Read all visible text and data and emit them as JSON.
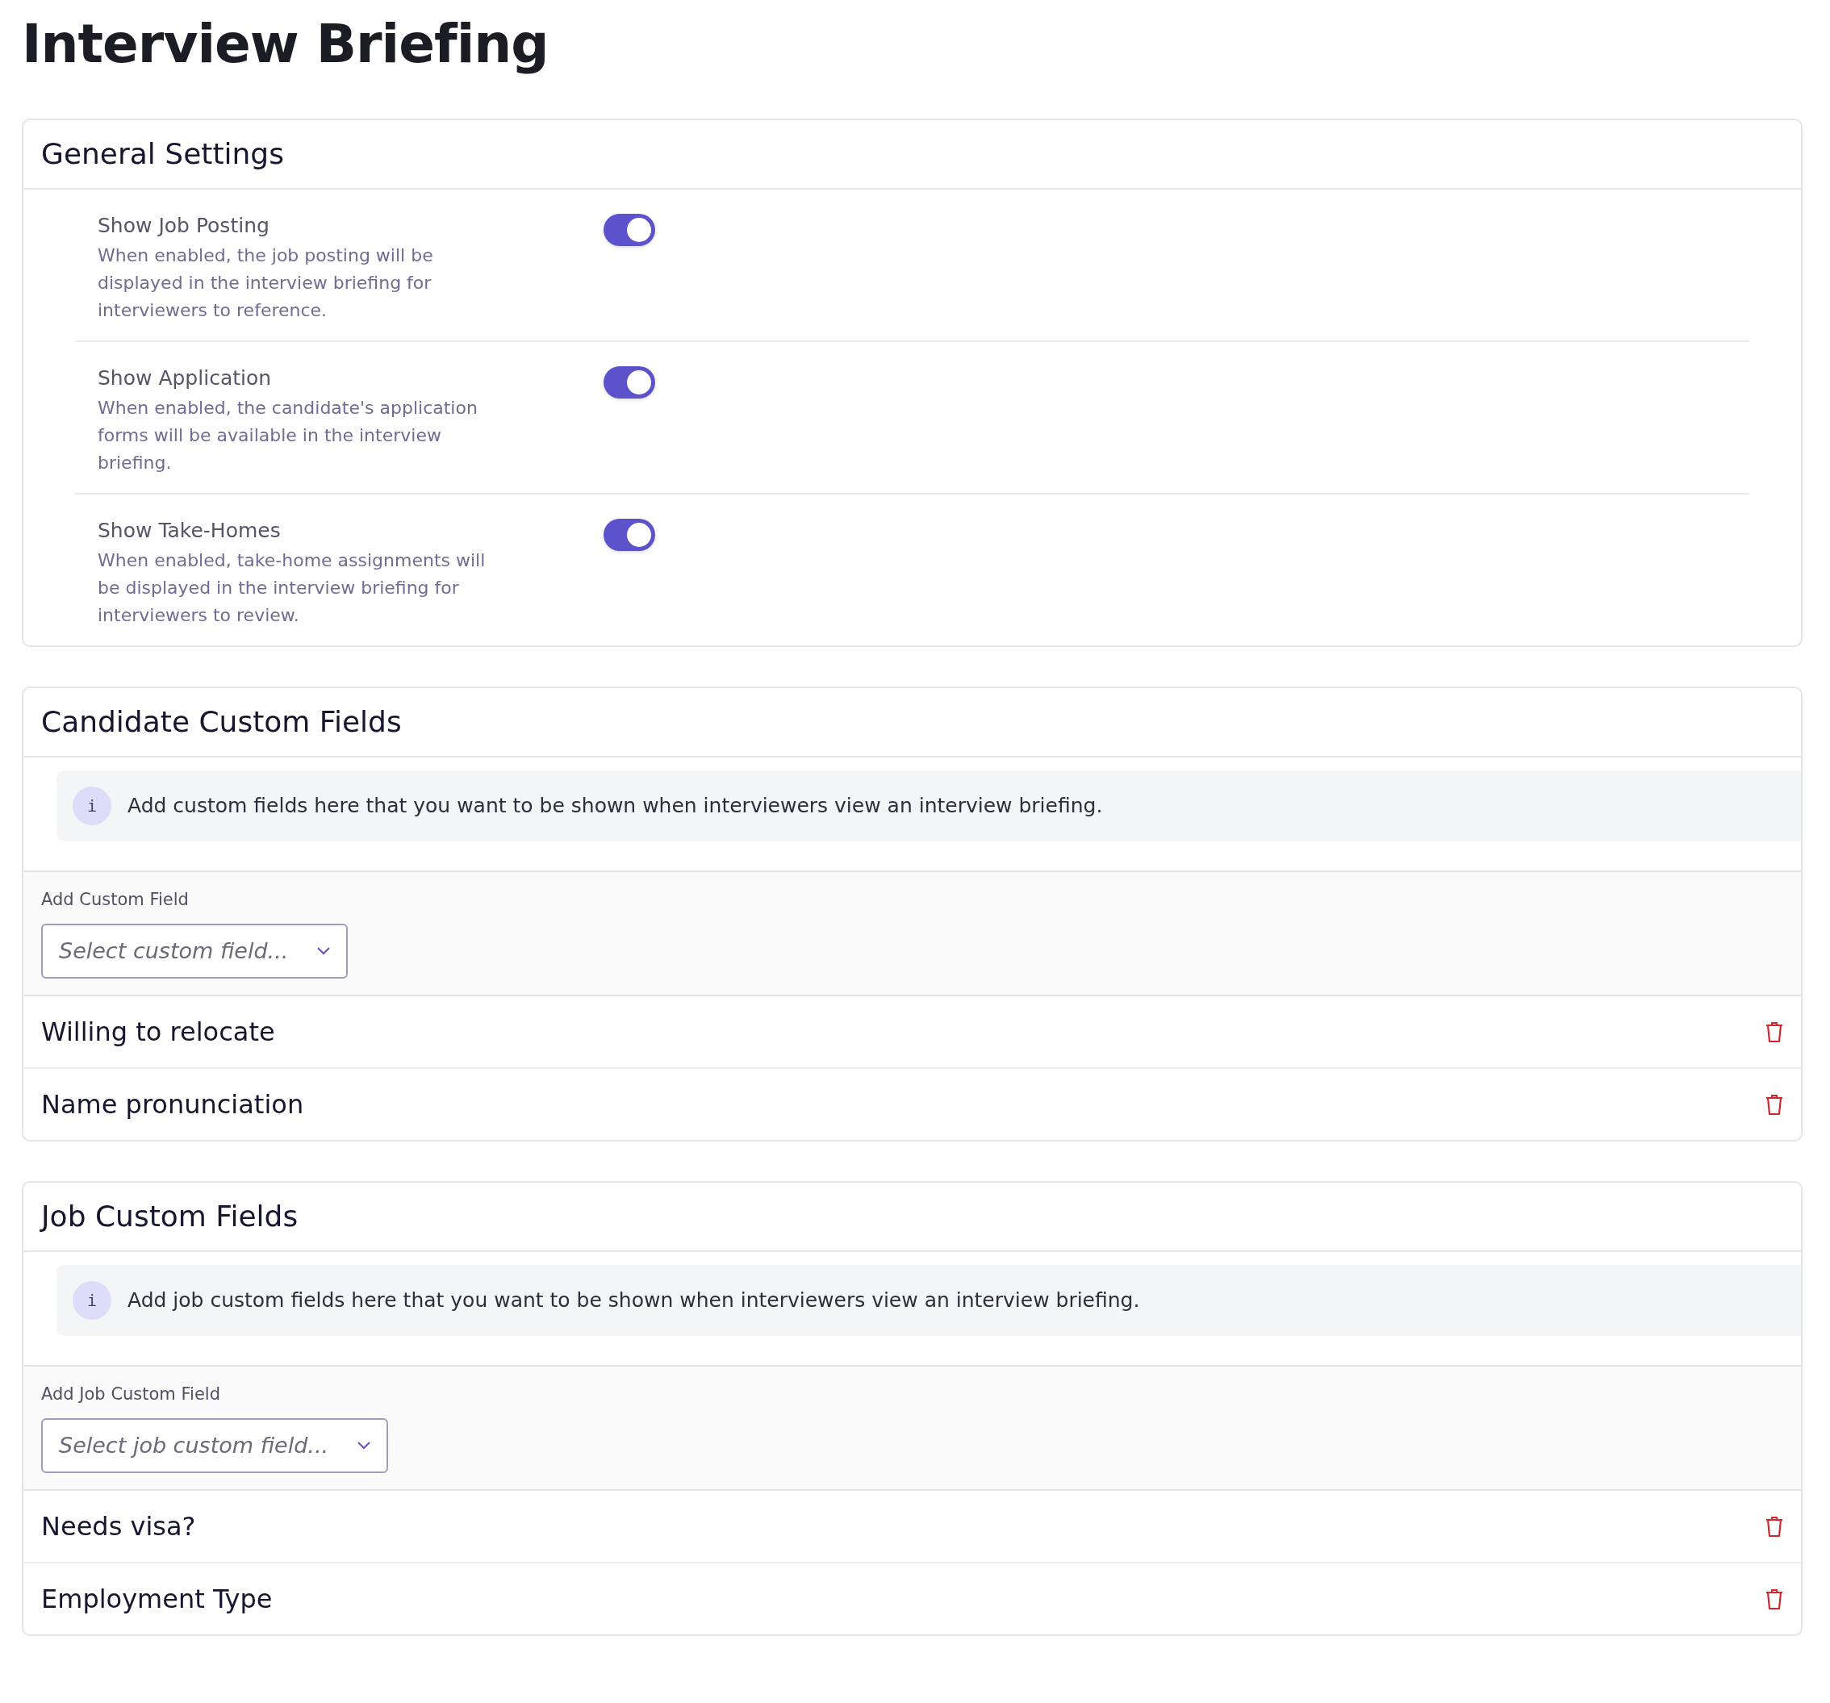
{
  "title": "Interview Briefing",
  "general_settings": {
    "title": "General Settings",
    "settings": [
      {
        "label": "Show Job Posting",
        "description": "When enabled, the job posting will be displayed in the interview briefing for interviewers to reference.",
        "on": true
      },
      {
        "label": "Show Application",
        "description": "When enabled, the candidate's application forms will be available in the interview briefing.",
        "on": true
      },
      {
        "label": "Show Take-Homes",
        "description": "When enabled, take-home assignments will be displayed in the interview briefing for interviewers to review.",
        "on": true
      }
    ]
  },
  "field_sections": [
    {
      "title": "Candidate Custom Fields",
      "info_icon": "i",
      "info": "Add custom fields here that you want to be shown when interviewers view an interview briefing.",
      "add_label": "Add Custom Field",
      "select": {
        "placeholder": "Select custom field..."
      },
      "fields": [
        "Willing to relocate",
        "Name pronunciation"
      ]
    },
    {
      "title": "Job Custom Fields",
      "info_icon": "i",
      "info": "Add job custom fields here that you want to be shown when interviewers view an interview briefing.",
      "add_label": "Add Job Custom Field",
      "select": {
        "placeholder": "Select job custom field..."
      },
      "fields": [
        "Needs visa?",
        "Employment Type"
      ]
    }
  ]
}
